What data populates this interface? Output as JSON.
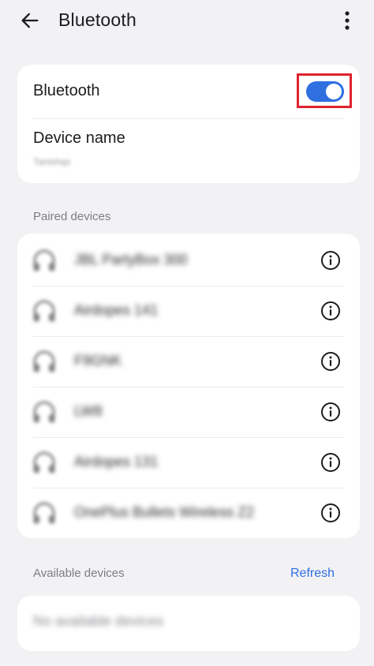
{
  "appbar": {
    "title": "Bluetooth",
    "back_icon": "arrow-left-icon",
    "more_icon": "more-vert-icon"
  },
  "main_card": {
    "bluetooth_label": "Bluetooth",
    "bluetooth_on": true,
    "device_name_label": "Device name",
    "device_name_value": "Tanishqs"
  },
  "paired": {
    "section_label": "Paired devices",
    "devices": [
      {
        "name": "JBL PartyBox 300",
        "icon": "headphones-icon"
      },
      {
        "name": "Airdopes 141",
        "icon": "headphones-icon"
      },
      {
        "name": "F9GNK",
        "icon": "headphones-icon"
      },
      {
        "name": "LW8",
        "icon": "headphones-icon"
      },
      {
        "name": "Airdopes 131",
        "icon": "headphones-icon"
      },
      {
        "name": "OnePlus Bullets Wireless Z2",
        "icon": "headphones-icon"
      }
    ]
  },
  "available": {
    "section_label": "Available devices",
    "refresh_label": "Refresh",
    "empty_text": "No available devices"
  },
  "colors": {
    "accent": "#2f6fe0",
    "highlight_box": "#e0222e",
    "background": "#f2f2f4"
  }
}
